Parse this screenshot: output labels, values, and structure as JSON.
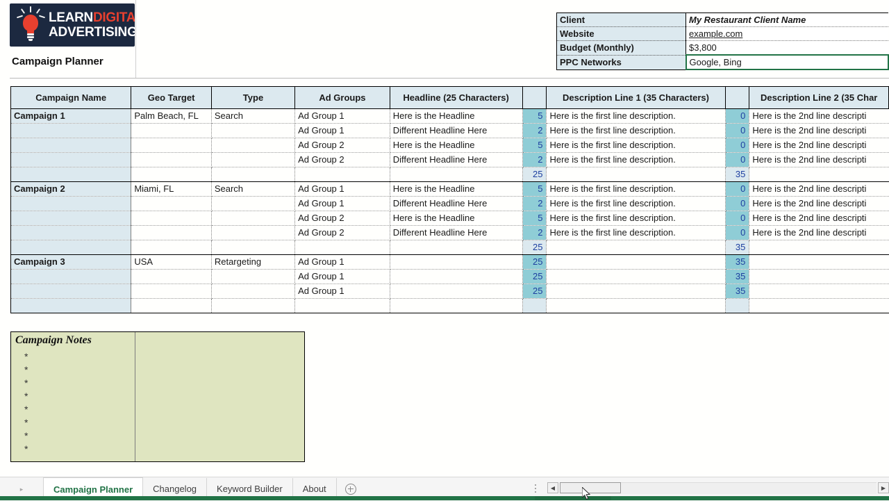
{
  "brand": {
    "logo_line1_white": "LEARN",
    "logo_line1_red": "DIGITAL",
    "logo_line2": "ADVERTISING",
    "logo_bg": "#1c2940",
    "accent_red": "#e8402f"
  },
  "page_title": "Campaign Planner",
  "client_info": {
    "rows": [
      {
        "label": "Client",
        "value": "My Restaurant Client Name"
      },
      {
        "label": "Website",
        "value": "example.com"
      },
      {
        "label": "Budget (Monthly)",
        "value": "$3,800"
      },
      {
        "label": "PPC Networks",
        "value": "Google, Bing"
      }
    ],
    "selected_row_index": 3,
    "selection_color": "#217346"
  },
  "grid": {
    "headers": {
      "campaign_name": "Campaign Name",
      "geo_target": "Geo Target",
      "type": "Type",
      "ad_groups": "Ad Groups",
      "headline": "Headline (25 Characters)",
      "headline_count": "",
      "description1": "Description Line 1 (35 Characters)",
      "description1_count": "",
      "description2": "Description Line 2 (35 Char"
    },
    "header_bg": "#dce9ef",
    "count_bar_color": "#8fcdd6",
    "count_text_color": "#1d3fa0",
    "campaigns": [
      {
        "name": "Campaign 1",
        "geo": "Palm Beach, FL",
        "type": "Search",
        "rows": [
          {
            "ad_group": "Ad Group 1",
            "headline": "Here is the Headline",
            "h_count": "5",
            "desc1": "Here is the first line description.",
            "d1_count": "0",
            "desc2": "Here is the 2nd line descripti"
          },
          {
            "ad_group": "Ad Group 1",
            "headline": "Different Headline Here",
            "h_count": "2",
            "desc1": "Here is the first line description.",
            "d1_count": "0",
            "desc2": "Here is the 2nd line descripti"
          },
          {
            "ad_group": "Ad Group 2",
            "headline": "Here is the Headline",
            "h_count": "5",
            "desc1": "Here is the first line description.",
            "d1_count": "0",
            "desc2": "Here is the 2nd line descripti"
          },
          {
            "ad_group": "Ad Group 2",
            "headline": "Different Headline Here",
            "h_count": "2",
            "desc1": "Here is the first line description.",
            "d1_count": "0",
            "desc2": "Here is the 2nd line descripti"
          }
        ],
        "summary": {
          "h_count": "25",
          "d1_count": "35"
        }
      },
      {
        "name": "Campaign 2",
        "geo": "Miami, FL",
        "type": "Search",
        "rows": [
          {
            "ad_group": "Ad Group 1",
            "headline": "Here is the Headline",
            "h_count": "5",
            "desc1": "Here is the first line description.",
            "d1_count": "0",
            "desc2": "Here is the 2nd line descripti"
          },
          {
            "ad_group": "Ad Group 1",
            "headline": "Different Headline Here",
            "h_count": "2",
            "desc1": "Here is the first line description.",
            "d1_count": "0",
            "desc2": "Here is the 2nd line descripti"
          },
          {
            "ad_group": "Ad Group 2",
            "headline": "Here is the Headline",
            "h_count": "5",
            "desc1": "Here is the first line description.",
            "d1_count": "0",
            "desc2": "Here is the 2nd line descripti"
          },
          {
            "ad_group": "Ad Group 2",
            "headline": "Different Headline Here",
            "h_count": "2",
            "desc1": "Here is the first line description.",
            "d1_count": "0",
            "desc2": "Here is the 2nd line descripti"
          }
        ],
        "summary": {
          "h_count": "25",
          "d1_count": "35"
        }
      },
      {
        "name": "Campaign 3",
        "geo": "USA",
        "type": "Retargeting",
        "rows": [
          {
            "ad_group": "Ad Group 1",
            "headline": "",
            "h_count": "25",
            "desc1": "",
            "d1_count": "35",
            "desc2": ""
          },
          {
            "ad_group": "Ad Group 1",
            "headline": "",
            "h_count": "25",
            "desc1": "",
            "d1_count": "35",
            "desc2": ""
          },
          {
            "ad_group": "Ad Group 1",
            "headline": "",
            "h_count": "25",
            "desc1": "",
            "d1_count": "35",
            "desc2": ""
          }
        ],
        "summary": {
          "h_count": "",
          "d1_count": ""
        }
      }
    ]
  },
  "notes": {
    "title": "Campaign Notes",
    "bullets": [
      "*",
      "*",
      "*",
      "*",
      "*",
      "*",
      "*",
      "*"
    ],
    "bg": "#dfe5c0"
  },
  "tabbar": {
    "nav_arrow": "▸",
    "tabs": [
      {
        "label": "Campaign Planner",
        "active": true
      },
      {
        "label": "Changelog",
        "active": false
      },
      {
        "label": "Keyword Builder",
        "active": false
      },
      {
        "label": "About",
        "active": false
      }
    ],
    "add_sheet": "+",
    "scroll_left": "◀",
    "scroll_right": "▶",
    "active_tab_color": "#217346"
  }
}
